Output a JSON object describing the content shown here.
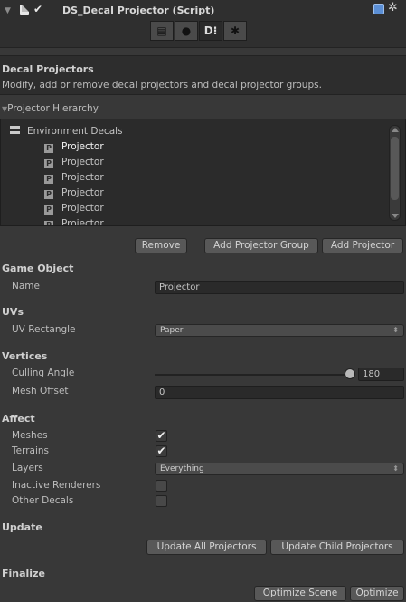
{
  "header": {
    "title": "DS_Decal Projector (Script)",
    "enabled": true,
    "tabs": [
      {
        "icon": "document-icon",
        "glyph": "▤",
        "active": false
      },
      {
        "icon": "map-pin-icon",
        "glyph": "●",
        "active": false
      },
      {
        "icon": "decal-icon",
        "glyph": "D⁝",
        "active": true
      },
      {
        "icon": "gear-icon",
        "glyph": "✱",
        "active": false
      }
    ]
  },
  "info": {
    "title": "Decal Projectors",
    "description": "Modify, add or remove decal projectors and decal projector groups."
  },
  "hierarchy": {
    "label": "Projector Hierarchy",
    "group": "Environment Decals",
    "items": [
      "Projector",
      "Projector",
      "Projector",
      "Projector",
      "Projector",
      "Projector"
    ],
    "item_icon_letter": "P"
  },
  "buttons": {
    "remove": "Remove",
    "add_group": "Add Projector Group",
    "add_projector": "Add Projector",
    "update_all": "Update All Projectors",
    "update_child": "Update Child Projectors",
    "optimize_scene": "Optimize Scene",
    "optimize": "Optimize"
  },
  "game_object": {
    "section": "Game Object",
    "name_label": "Name",
    "name_value": "Projector"
  },
  "uvs": {
    "section": "UVs",
    "rect_label": "UV Rectangle",
    "rect_value": "Paper"
  },
  "vertices": {
    "section": "Vertices",
    "culling_label": "Culling Angle",
    "culling_value": "180",
    "culling_fraction": 1.0,
    "mesh_offset_label": "Mesh Offset",
    "mesh_offset_value": "0"
  },
  "affect": {
    "section": "Affect",
    "meshes_label": "Meshes",
    "meshes": true,
    "terrains_label": "Terrains",
    "terrains": true,
    "layers_label": "Layers",
    "layers_value": "Everything",
    "inactive_label": "Inactive Renderers",
    "inactive": false,
    "other_label": "Other Decals",
    "other": false
  },
  "update": {
    "section": "Update"
  },
  "finalize": {
    "section": "Finalize"
  }
}
